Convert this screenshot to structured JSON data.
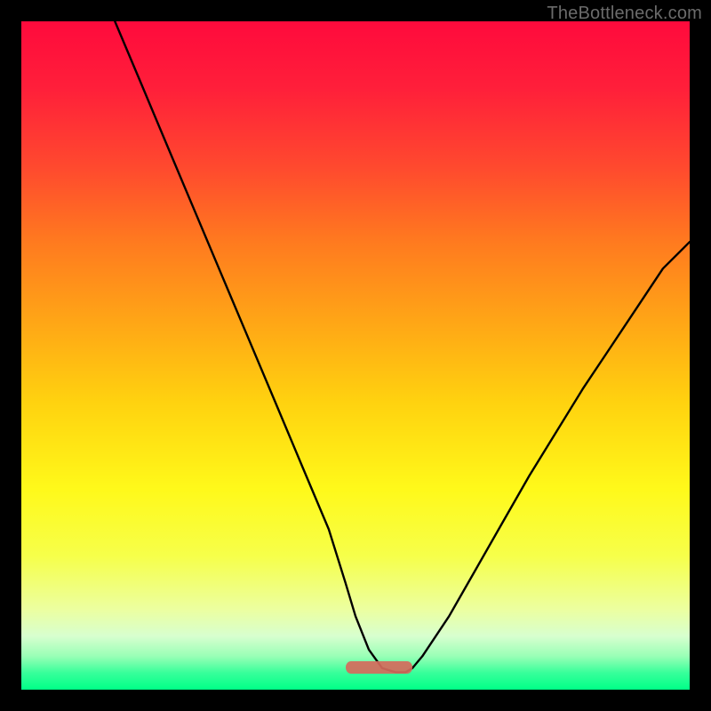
{
  "watermark": "TheBottleneck.com",
  "chart_data": {
    "type": "line",
    "title": "",
    "xlabel": "",
    "ylabel": "",
    "xlim": [
      0,
      100
    ],
    "ylim": [
      0,
      100
    ],
    "series": [
      {
        "name": "bottleneck-curve",
        "x": [
          14,
          18,
          22,
          26,
          30,
          34,
          38,
          42,
          46,
          48.5,
          50,
          52,
          54,
          56,
          57.5,
          58.5,
          60,
          64,
          68,
          72,
          76,
          80,
          84,
          88,
          92,
          96,
          100
        ],
        "y": [
          100,
          90.5,
          81,
          71.5,
          62,
          52.5,
          43,
          33.5,
          24,
          16,
          11,
          6,
          3.2,
          2.6,
          2.6,
          3.2,
          5,
          11,
          18,
          25,
          32,
          38.5,
          45,
          51,
          57,
          63,
          67
        ]
      }
    ],
    "highlight_region": {
      "x_start": 48.5,
      "x_end": 58.5,
      "y": 2.6
    },
    "gradient_background": {
      "direction": "vertical",
      "stops": [
        {
          "pos": 0.0,
          "color": "#ff0a3c"
        },
        {
          "pos": 0.5,
          "color": "#ffd20f"
        },
        {
          "pos": 0.95,
          "color": "#99ffb6"
        },
        {
          "pos": 1.0,
          "color": "#00ff88"
        }
      ]
    }
  }
}
